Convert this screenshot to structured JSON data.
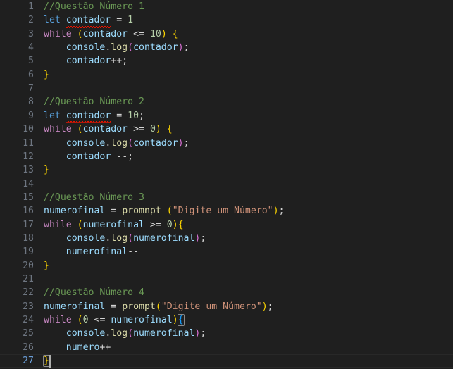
{
  "editor": {
    "theme": "dark-plus",
    "background": "#1f1f1f",
    "foreground": "#d4d4d4",
    "gutter_color": "#6e7681",
    "active_gutter_color": "#6b9ed8",
    "language": "javascript",
    "total_lines": 27,
    "active_line": 27,
    "cursor": {
      "line": 27,
      "column": 2
    }
  },
  "colors": {
    "comment": "#6A9955",
    "keyword": "#569CD6",
    "control": "#C586C0",
    "variable": "#9CDCFE",
    "function": "#DCDCAA",
    "number": "#B5CEA8",
    "string": "#CE9178",
    "operator": "#D4D4D4",
    "bracket_yellow": "#FFD700",
    "bracket_magenta": "#DA70D6",
    "bracket_blue": "#179FFF",
    "squiggle": "#e51400",
    "indent_guide": "#474747"
  },
  "lines": [
    {
      "number": "1",
      "indent": 0,
      "tokens": [
        {
          "text": "//Questão Número 1",
          "type": "comment"
        }
      ]
    },
    {
      "number": "2",
      "indent": 0,
      "tokens": [
        {
          "text": "let",
          "type": "keyword"
        },
        {
          "text": " ",
          "type": "plain"
        },
        {
          "text": "contador",
          "type": "var",
          "squiggle": true
        },
        {
          "text": " ",
          "type": "plain"
        },
        {
          "text": "=",
          "type": "op"
        },
        {
          "text": " ",
          "type": "plain"
        },
        {
          "text": "1",
          "type": "num"
        }
      ]
    },
    {
      "number": "3",
      "indent": 0,
      "tokens": [
        {
          "text": "while",
          "type": "control"
        },
        {
          "text": " ",
          "type": "plain"
        },
        {
          "text": "(",
          "type": "par-y"
        },
        {
          "text": "contador",
          "type": "var"
        },
        {
          "text": " ",
          "type": "plain"
        },
        {
          "text": "<=",
          "type": "op"
        },
        {
          "text": " ",
          "type": "plain"
        },
        {
          "text": "10",
          "type": "num"
        },
        {
          "text": ")",
          "type": "par-y"
        },
        {
          "text": " ",
          "type": "plain"
        },
        {
          "text": "{",
          "type": "par-y"
        }
      ]
    },
    {
      "number": "4",
      "indent": 1,
      "tokens": [
        {
          "text": "    ",
          "type": "plain"
        },
        {
          "text": "console",
          "type": "var"
        },
        {
          "text": ".",
          "type": "punct"
        },
        {
          "text": "log",
          "type": "func"
        },
        {
          "text": "(",
          "type": "par-m"
        },
        {
          "text": "contador",
          "type": "var"
        },
        {
          "text": ")",
          "type": "par-m"
        },
        {
          "text": ";",
          "type": "punct"
        }
      ]
    },
    {
      "number": "5",
      "indent": 1,
      "tokens": [
        {
          "text": "    ",
          "type": "plain"
        },
        {
          "text": "contador",
          "type": "var"
        },
        {
          "text": "++",
          "type": "op"
        },
        {
          "text": ";",
          "type": "punct"
        }
      ]
    },
    {
      "number": "6",
      "indent": 0,
      "tokens": [
        {
          "text": "}",
          "type": "par-y"
        }
      ]
    },
    {
      "number": "7",
      "indent": 0,
      "tokens": []
    },
    {
      "number": "8",
      "indent": 0,
      "tokens": [
        {
          "text": "//Questão Número 2",
          "type": "comment"
        }
      ]
    },
    {
      "number": "9",
      "indent": 0,
      "tokens": [
        {
          "text": "let",
          "type": "keyword"
        },
        {
          "text": " ",
          "type": "plain"
        },
        {
          "text": "contador",
          "type": "var",
          "squiggle": true
        },
        {
          "text": " ",
          "type": "plain"
        },
        {
          "text": "=",
          "type": "op"
        },
        {
          "text": " ",
          "type": "plain"
        },
        {
          "text": "10",
          "type": "num"
        },
        {
          "text": ";",
          "type": "punct"
        }
      ]
    },
    {
      "number": "10",
      "indent": 0,
      "tokens": [
        {
          "text": "while",
          "type": "control"
        },
        {
          "text": " ",
          "type": "plain"
        },
        {
          "text": "(",
          "type": "par-y"
        },
        {
          "text": "contador",
          "type": "var"
        },
        {
          "text": " ",
          "type": "plain"
        },
        {
          "text": ">=",
          "type": "op"
        },
        {
          "text": " ",
          "type": "plain"
        },
        {
          "text": "0",
          "type": "num"
        },
        {
          "text": ")",
          "type": "par-y"
        },
        {
          "text": " ",
          "type": "plain"
        },
        {
          "text": "{",
          "type": "par-y"
        }
      ]
    },
    {
      "number": "11",
      "indent": 1,
      "tokens": [
        {
          "text": "    ",
          "type": "plain"
        },
        {
          "text": "console",
          "type": "var"
        },
        {
          "text": ".",
          "type": "punct"
        },
        {
          "text": "log",
          "type": "func"
        },
        {
          "text": "(",
          "type": "par-m"
        },
        {
          "text": "contador",
          "type": "var"
        },
        {
          "text": ")",
          "type": "par-m"
        },
        {
          "text": ";",
          "type": "punct"
        }
      ]
    },
    {
      "number": "12",
      "indent": 1,
      "tokens": [
        {
          "text": "    ",
          "type": "plain"
        },
        {
          "text": "contador",
          "type": "var"
        },
        {
          "text": " ",
          "type": "plain"
        },
        {
          "text": "--",
          "type": "op"
        },
        {
          "text": ";",
          "type": "punct"
        }
      ]
    },
    {
      "number": "13",
      "indent": 0,
      "tokens": [
        {
          "text": "}",
          "type": "par-y"
        }
      ]
    },
    {
      "number": "14",
      "indent": 0,
      "tokens": []
    },
    {
      "number": "15",
      "indent": 0,
      "tokens": [
        {
          "text": "//Questão Número 3",
          "type": "comment"
        }
      ]
    },
    {
      "number": "16",
      "indent": 0,
      "tokens": [
        {
          "text": "numerofinal",
          "type": "var"
        },
        {
          "text": " ",
          "type": "plain"
        },
        {
          "text": "=",
          "type": "op"
        },
        {
          "text": " ",
          "type": "plain"
        },
        {
          "text": "promnpt",
          "type": "func"
        },
        {
          "text": " ",
          "type": "plain"
        },
        {
          "text": "(",
          "type": "par-y"
        },
        {
          "text": "\"Digite um Número\"",
          "type": "string"
        },
        {
          "text": ")",
          "type": "par-y"
        },
        {
          "text": ";",
          "type": "punct"
        }
      ]
    },
    {
      "number": "17",
      "indent": 0,
      "tokens": [
        {
          "text": "while",
          "type": "control"
        },
        {
          "text": " ",
          "type": "plain"
        },
        {
          "text": "(",
          "type": "par-y"
        },
        {
          "text": "numerofinal",
          "type": "var"
        },
        {
          "text": " ",
          "type": "plain"
        },
        {
          "text": ">=",
          "type": "op"
        },
        {
          "text": " ",
          "type": "plain"
        },
        {
          "text": "0",
          "type": "num"
        },
        {
          "text": ")",
          "type": "par-y"
        },
        {
          "text": "{",
          "type": "par-y"
        }
      ]
    },
    {
      "number": "18",
      "indent": 1,
      "tokens": [
        {
          "text": "    ",
          "type": "plain"
        },
        {
          "text": "console",
          "type": "var"
        },
        {
          "text": ".",
          "type": "punct"
        },
        {
          "text": "log",
          "type": "func"
        },
        {
          "text": "(",
          "type": "par-m"
        },
        {
          "text": "numerofinal",
          "type": "var"
        },
        {
          "text": ")",
          "type": "par-m"
        },
        {
          "text": ";",
          "type": "punct"
        }
      ]
    },
    {
      "number": "19",
      "indent": 1,
      "tokens": [
        {
          "text": "    ",
          "type": "plain"
        },
        {
          "text": "numerofinal",
          "type": "var"
        },
        {
          "text": "--",
          "type": "op"
        }
      ]
    },
    {
      "number": "20",
      "indent": 0,
      "tokens": [
        {
          "text": "}",
          "type": "par-y"
        }
      ]
    },
    {
      "number": "21",
      "indent": 0,
      "tokens": []
    },
    {
      "number": "22",
      "indent": 0,
      "tokens": [
        {
          "text": "//Questão Número 4",
          "type": "comment"
        }
      ]
    },
    {
      "number": "23",
      "indent": 0,
      "tokens": [
        {
          "text": "numerofinal",
          "type": "var"
        },
        {
          "text": " ",
          "type": "plain"
        },
        {
          "text": "=",
          "type": "op"
        },
        {
          "text": " ",
          "type": "plain"
        },
        {
          "text": "prompt",
          "type": "func"
        },
        {
          "text": "(",
          "type": "par-y"
        },
        {
          "text": "\"Digite um Número\"",
          "type": "string"
        },
        {
          "text": ")",
          "type": "par-y"
        },
        {
          "text": ";",
          "type": "punct"
        }
      ]
    },
    {
      "number": "24",
      "indent": 0,
      "tokens": [
        {
          "text": "while",
          "type": "control"
        },
        {
          "text": " ",
          "type": "plain"
        },
        {
          "text": "(",
          "type": "par-y"
        },
        {
          "text": "0",
          "type": "num"
        },
        {
          "text": " ",
          "type": "plain"
        },
        {
          "text": "<=",
          "type": "op"
        },
        {
          "text": " ",
          "type": "plain"
        },
        {
          "text": "numerofinal",
          "type": "var"
        },
        {
          "text": ")",
          "type": "par-y"
        },
        {
          "text": "{",
          "type": "par-b",
          "bracket_match": true
        }
      ]
    },
    {
      "number": "25",
      "indent": 1,
      "tokens": [
        {
          "text": "    ",
          "type": "plain"
        },
        {
          "text": "console",
          "type": "var"
        },
        {
          "text": ".",
          "type": "punct"
        },
        {
          "text": "log",
          "type": "func"
        },
        {
          "text": "(",
          "type": "par-m"
        },
        {
          "text": "numerofinal",
          "type": "var"
        },
        {
          "text": ")",
          "type": "par-m"
        },
        {
          "text": ";",
          "type": "punct"
        }
      ]
    },
    {
      "number": "26",
      "indent": 1,
      "tokens": [
        {
          "text": "    ",
          "type": "plain"
        },
        {
          "text": "numero",
          "type": "var"
        },
        {
          "text": "++",
          "type": "op"
        }
      ]
    },
    {
      "number": "27",
      "indent": 0,
      "active": true,
      "cursor_after": 1,
      "tokens": [
        {
          "text": "}",
          "type": "par-y",
          "bracket_match": true
        }
      ]
    }
  ]
}
